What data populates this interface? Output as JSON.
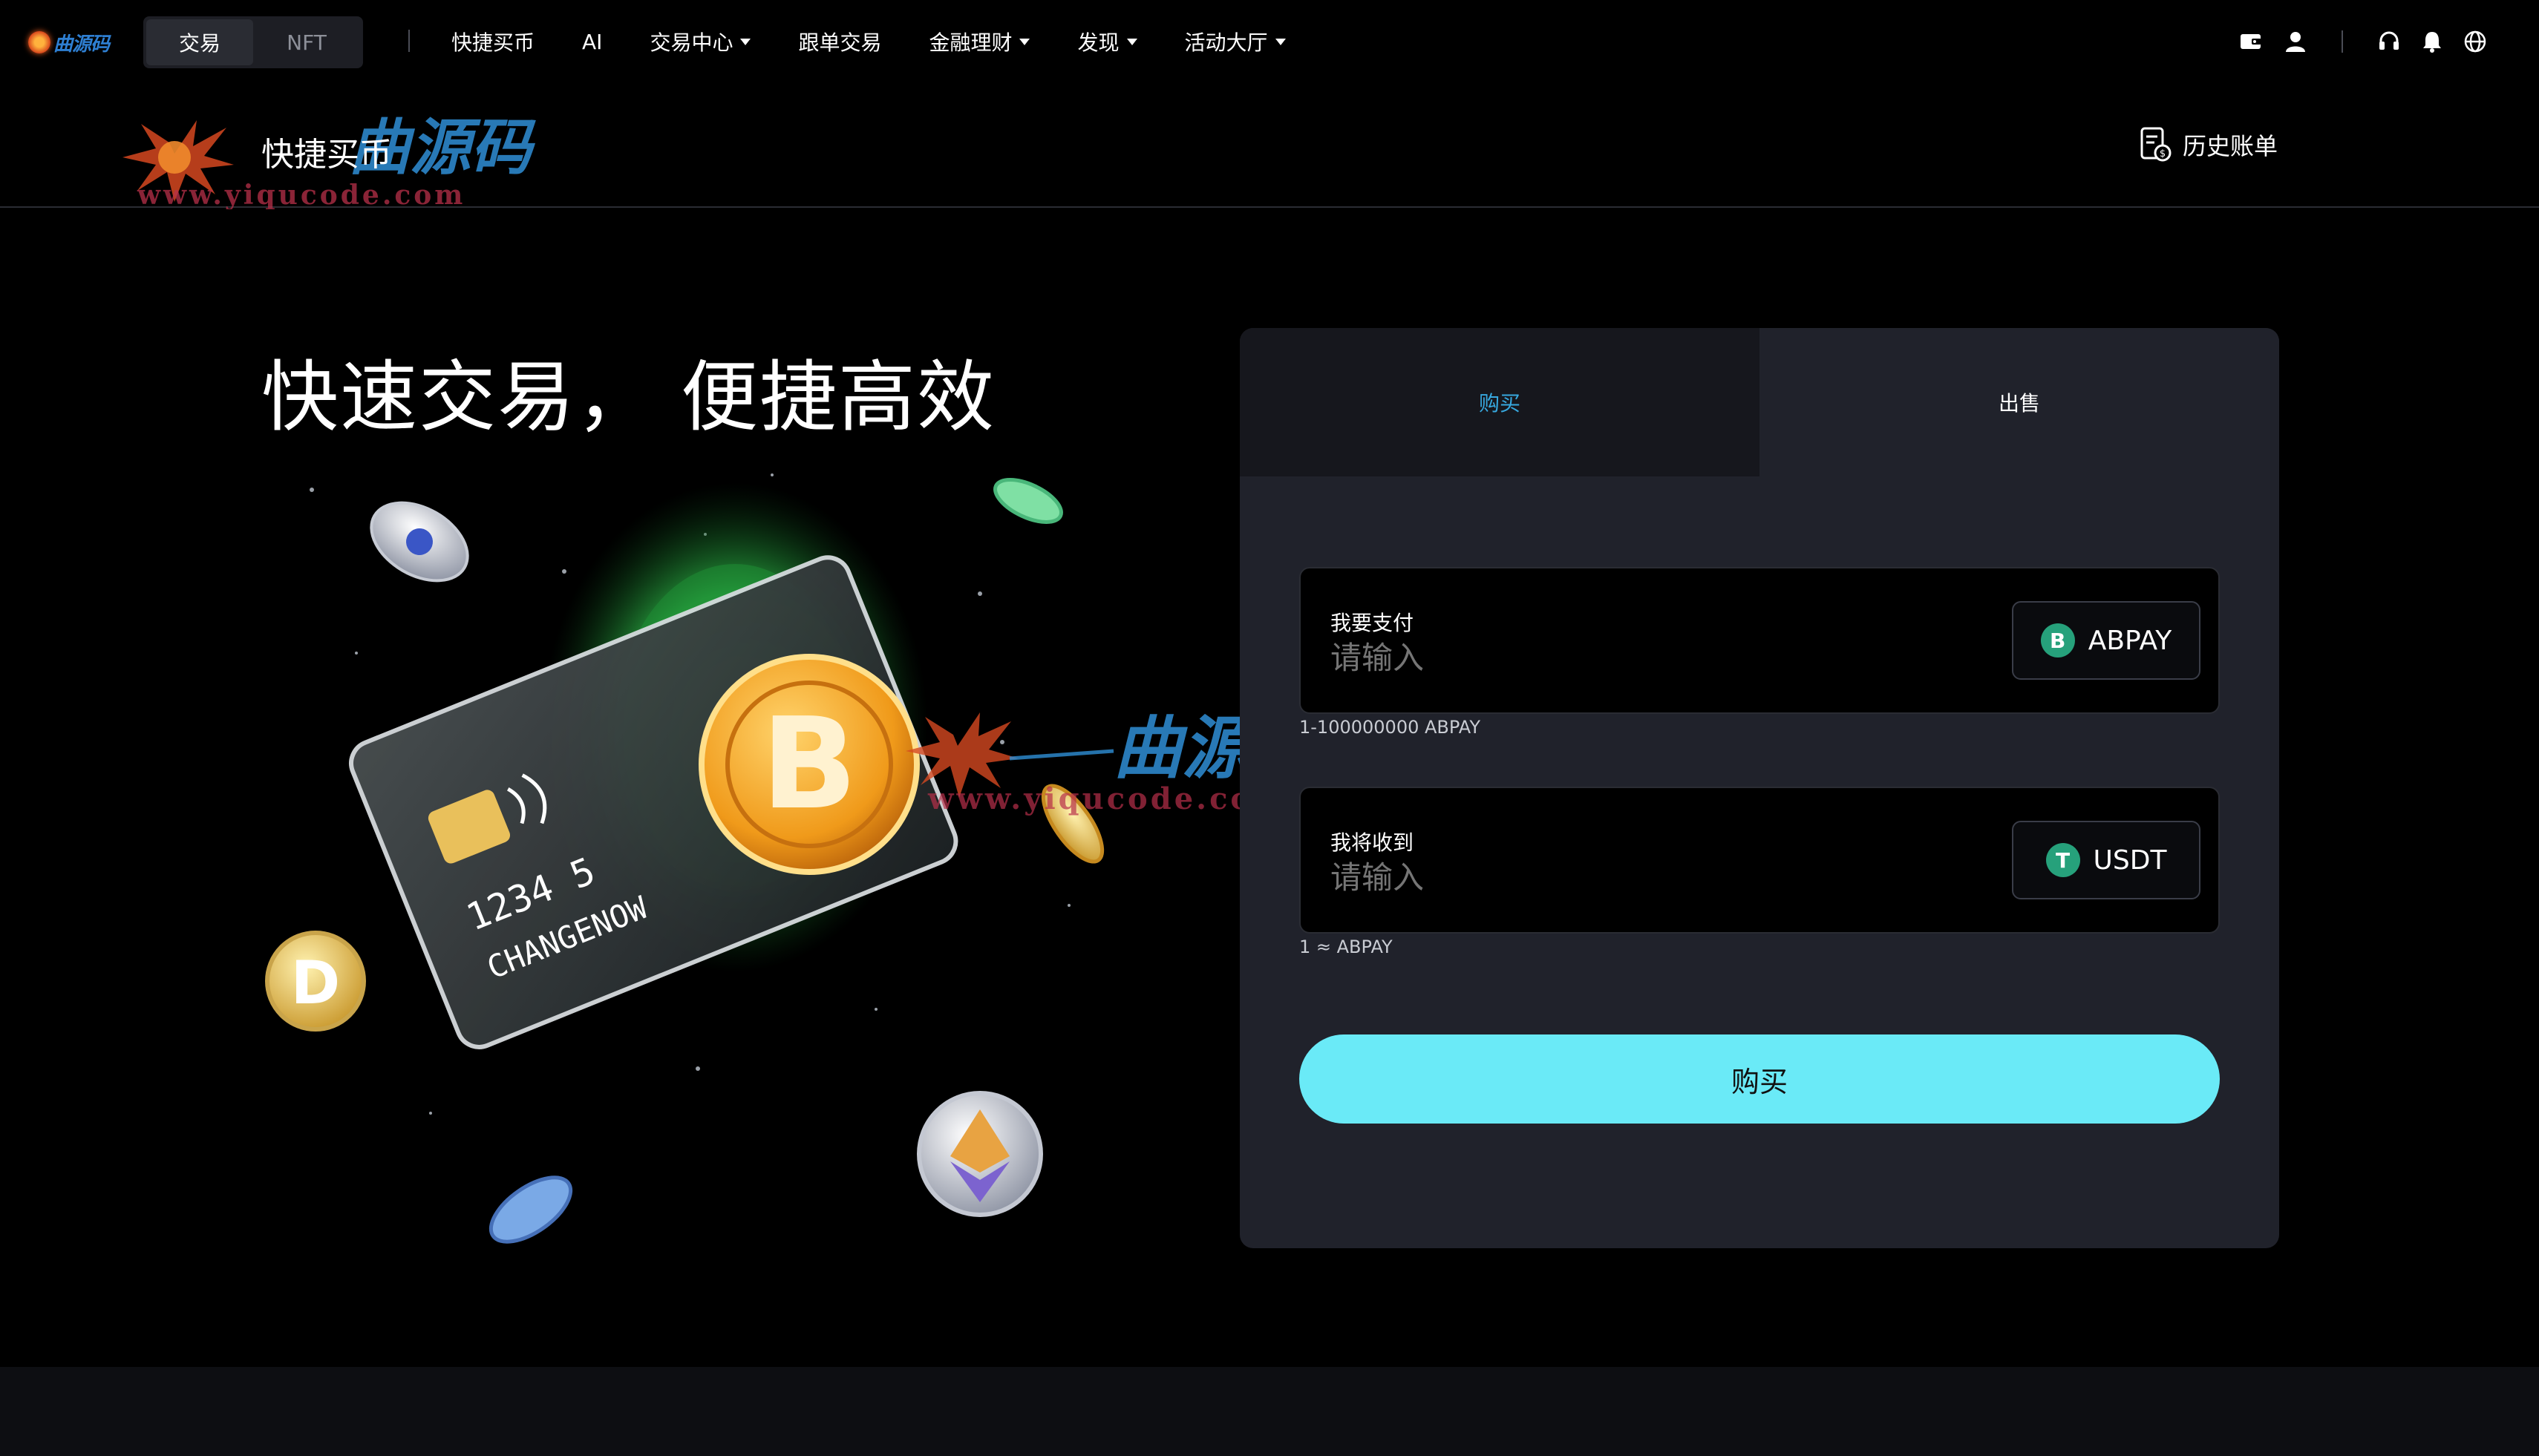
{
  "nav": {
    "logo_text": "曲源码",
    "mode_tabs": [
      {
        "label": "交易",
        "active": true
      },
      {
        "label": "NFT",
        "active": false
      }
    ],
    "items": [
      {
        "label": "快捷买币",
        "dropdown": false
      },
      {
        "label": "AI",
        "dropdown": false
      },
      {
        "label": "交易中心",
        "dropdown": true
      },
      {
        "label": "跟单交易",
        "dropdown": false
      },
      {
        "label": "金融理财",
        "dropdown": true
      },
      {
        "label": "发现",
        "dropdown": true
      },
      {
        "label": "活动大厅",
        "dropdown": true
      }
    ],
    "right_icons": [
      "wallet-icon",
      "user-icon",
      "headset-icon",
      "bell-icon",
      "globe-icon"
    ]
  },
  "subheader": {
    "title": "快捷买币",
    "history_label": "历史账单"
  },
  "hero": {
    "title": "快速交易， 便捷高效",
    "card_number": "1234 5",
    "card_name": "CHANGENOW"
  },
  "panel": {
    "tabs": [
      {
        "label": "购买",
        "active": true
      },
      {
        "label": "出售",
        "active": false
      }
    ],
    "pay": {
      "label": "我要支付",
      "placeholder": "请输入",
      "currency": "ABPAY",
      "currency_icon": "B",
      "hint": "1-100000000 ABPAY"
    },
    "receive": {
      "label": "我将收到",
      "placeholder": "请输入",
      "currency": "USDT",
      "currency_icon": "T",
      "hint": "1 ≈ ABPAY"
    },
    "submit_label": "购买"
  },
  "watermark": {
    "brand": "曲源码",
    "url": "www.yiqucode.com"
  },
  "colors": {
    "accent": "#6aeaf7",
    "tab_active": "#37a8df",
    "panel_bg": "#20222b",
    "usdt_green": "#26a17b"
  }
}
